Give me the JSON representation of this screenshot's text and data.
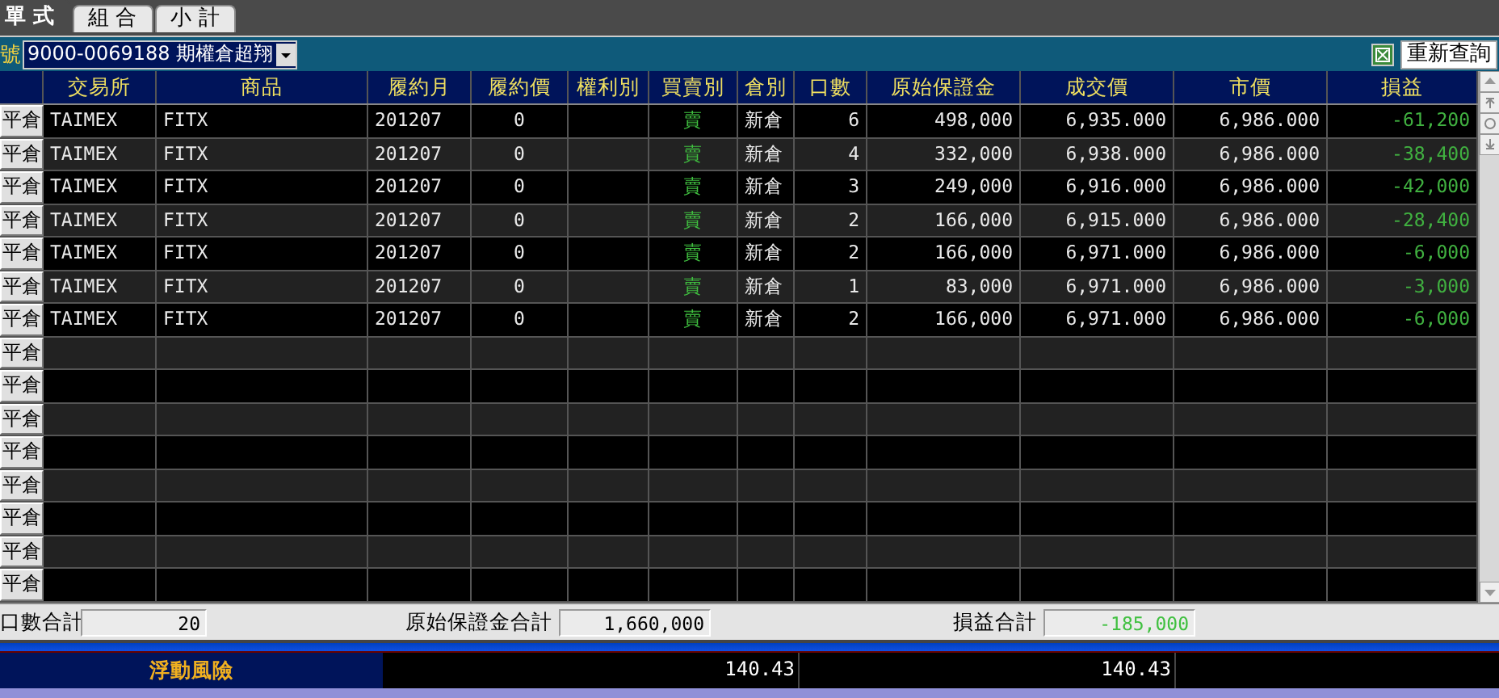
{
  "tabs": [
    {
      "label": "單 式",
      "selected": true
    },
    {
      "label": "組 合",
      "selected": false
    },
    {
      "label": "小 計",
      "selected": false
    }
  ],
  "account": {
    "label": "號",
    "value": "9000-0069188 期權倉超翔"
  },
  "refresh_button": "重新查詢",
  "table": {
    "columns": [
      "交易所",
      "商品",
      "履約月",
      "履約價",
      "權利別",
      "買賣別",
      "倉別",
      "口數",
      "原始保證金",
      "成交價",
      "市價",
      "損益"
    ],
    "rows": [
      {
        "action": "平倉",
        "cells": [
          "TAIMEX",
          "FITX",
          "201207",
          "0",
          null,
          "賣",
          "新倉",
          "6",
          "498,000",
          "6,935.000",
          "6,986.000",
          "-61,200"
        ]
      },
      {
        "action": "平倉",
        "cells": [
          "TAIMEX",
          "FITX",
          "201207",
          "0",
          null,
          "賣",
          "新倉",
          "4",
          "332,000",
          "6,938.000",
          "6,986.000",
          "-38,400"
        ]
      },
      {
        "action": "平倉",
        "cells": [
          "TAIMEX",
          "FITX",
          "201207",
          "0",
          null,
          "賣",
          "新倉",
          "3",
          "249,000",
          "6,916.000",
          "6,986.000",
          "-42,000"
        ]
      },
      {
        "action": "平倉",
        "cells": [
          "TAIMEX",
          "FITX",
          "201207",
          "0",
          null,
          "賣",
          "新倉",
          "2",
          "166,000",
          "6,915.000",
          "6,986.000",
          "-28,400"
        ]
      },
      {
        "action": "平倉",
        "cells": [
          "TAIMEX",
          "FITX",
          "201207",
          "0",
          null,
          "賣",
          "新倉",
          "2",
          "166,000",
          "6,971.000",
          "6,986.000",
          "-6,000"
        ]
      },
      {
        "action": "平倉",
        "cells": [
          "TAIMEX",
          "FITX",
          "201207",
          "0",
          null,
          "賣",
          "新倉",
          "1",
          "83,000",
          "6,971.000",
          "6,986.000",
          "-3,000"
        ]
      },
      {
        "action": "平倉",
        "cells": [
          "TAIMEX",
          "FITX",
          "201207",
          "0",
          null,
          "賣",
          "新倉",
          "2",
          "166,000",
          "6,971.000",
          "6,986.000",
          "-6,000"
        ]
      },
      {
        "action": "平倉"
      },
      {
        "action": "平倉"
      },
      {
        "action": "平倉"
      },
      {
        "action": "平倉"
      },
      {
        "action": "平倉"
      },
      {
        "action": "平倉"
      },
      {
        "action": "平倉"
      },
      {
        "action": "平倉"
      }
    ]
  },
  "summary": [
    {
      "label": "口數合計",
      "value": "20",
      "kind": "plain"
    },
    {
      "label": "原始保證金合計",
      "value": "1,660,000",
      "kind": "plain"
    },
    {
      "label": "損益合計",
      "value": "-185,000",
      "kind": "pnl"
    }
  ],
  "risk": {
    "label": "浮動風險",
    "values": [
      "140.43",
      "140.43"
    ]
  }
}
